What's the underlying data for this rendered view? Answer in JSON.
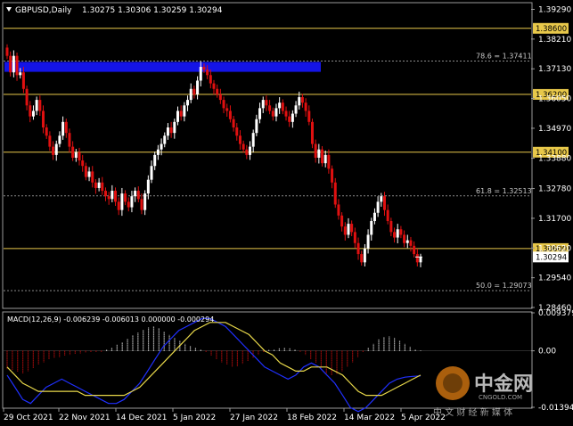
{
  "header": {
    "symbol_tf": "GBPUSD,Daily",
    "ohlc": "1.30275 1.30306 1.30259 1.30294"
  },
  "price_axis": {
    "ticks": [
      "1.39290",
      "1.38210",
      "1.37130",
      "1.36050",
      "1.34970",
      "1.33880",
      "1.32780",
      "1.31700",
      "1.30620",
      "1.29540",
      "1.28460"
    ],
    "tick_values": [
      1.3929,
      1.3821,
      1.3713,
      1.3605,
      1.3497,
      1.3388,
      1.3278,
      1.317,
      1.3062,
      1.2954,
      1.2846
    ],
    "range": [
      1.2846,
      1.395
    ]
  },
  "levels": [
    {
      "value": 1.386,
      "label": "1.38600",
      "color": "#e8c84a"
    },
    {
      "value": 1.362,
      "label": "1.36200",
      "color": "#e8c84a"
    },
    {
      "value": 1.341,
      "label": "1.34100",
      "color": "#e8c84a"
    },
    {
      "value": 1.306,
      "label": "1.30600",
      "color": "#e8c84a"
    }
  ],
  "current_price": {
    "value": 1.30294,
    "label": "1.30294"
  },
  "fibs": [
    {
      "value": 1.37411,
      "label": "78.6 = 1.37411"
    },
    {
      "value": 1.32513,
      "label": "61.8 = 1.32513"
    },
    {
      "value": 1.29073,
      "label": "50.0 = 1.29073"
    }
  ],
  "zone": {
    "top": 1.3738,
    "bottom": 1.3702,
    "color": "#1414e6"
  },
  "macd": {
    "label": "MACD(12,26,9) -0.006239 -0.006013 0.000000 -0.000294",
    "ticks": [
      "0.009379",
      "0.00",
      "-0.013941"
    ],
    "tick_values": [
      0.009379,
      0.0,
      -0.013941
    ]
  },
  "date_axis": [
    "29 Oct 2021",
    "22 Nov 2021",
    "14 Dec 2021",
    "5 Jan 2022",
    "27 Jan 2022",
    "18 Feb 2022",
    "14 Mar 2022",
    "5 Apr 2022"
  ],
  "chart_data": {
    "type": "candlestick",
    "close": [
      1.376,
      1.37,
      1.376,
      1.369,
      1.37,
      1.364,
      1.358,
      1.354,
      1.356,
      1.36,
      1.356,
      1.35,
      1.347,
      1.343,
      1.34,
      1.344,
      1.347,
      1.352,
      1.348,
      1.343,
      1.339,
      1.341,
      1.338,
      1.336,
      1.332,
      1.334,
      1.33,
      1.328,
      1.33,
      1.327,
      1.325,
      1.324,
      1.327,
      1.323,
      1.32,
      1.326,
      1.323,
      1.321,
      1.325,
      1.327,
      1.324,
      1.32,
      1.326,
      1.331,
      1.336,
      1.34,
      1.342,
      1.344,
      1.347,
      1.35,
      1.348,
      1.352,
      1.356,
      1.354,
      1.358,
      1.36,
      1.364,
      1.362,
      1.367,
      1.372,
      1.371,
      1.369,
      1.366,
      1.364,
      1.362,
      1.36,
      1.357,
      1.356,
      1.353,
      1.35,
      1.347,
      1.344,
      1.342,
      1.34,
      1.343,
      1.348,
      1.353,
      1.357,
      1.36,
      1.358,
      1.356,
      1.354,
      1.357,
      1.359,
      1.356,
      1.354,
      1.352,
      1.355,
      1.358,
      1.361,
      1.359,
      1.356,
      1.352,
      1.344,
      1.339,
      1.342,
      1.337,
      1.34,
      1.335,
      1.33,
      1.322,
      1.318,
      1.314,
      1.311,
      1.315,
      1.312,
      1.308,
      1.304,
      1.301,
      1.306,
      1.311,
      1.316,
      1.319,
      1.323,
      1.325,
      1.32,
      1.316,
      1.312,
      1.31,
      1.313,
      1.311,
      1.308,
      1.309,
      1.307,
      1.304,
      1.301,
      1.3029
    ],
    "macd_hist": [
      -0.0045,
      -0.0048,
      -0.0052,
      -0.0055,
      -0.005,
      -0.0042,
      -0.0035,
      -0.0028,
      -0.0022,
      -0.0018,
      -0.0015,
      -0.0012,
      -0.001,
      -0.0008,
      -0.0006,
      -0.0005,
      -0.0004,
      -0.0003,
      -0.0002,
      0.0003,
      0.0008,
      0.0015,
      0.0022,
      0.003,
      0.0038,
      0.0045,
      0.0052,
      0.0058,
      0.006,
      0.0055,
      0.0048,
      0.004,
      0.0032,
      0.0025,
      0.0018,
      0.0012,
      0.0008,
      0.0004,
      -0.0004,
      -0.0012,
      -0.002,
      -0.0028,
      -0.0035,
      -0.004,
      -0.0038,
      -0.0032,
      -0.0025,
      -0.0018,
      -0.001,
      -0.0004,
      0.0002,
      0.0004,
      0.0006,
      0.0008,
      0.0006,
      0.0003,
      -0.0002,
      -0.001,
      -0.002,
      -0.003,
      -0.0042,
      -0.0055,
      -0.006,
      -0.0058,
      -0.005,
      -0.004,
      -0.0028,
      -0.0015,
      -0.0004,
      0.0008,
      0.0018,
      0.0028,
      0.0034,
      0.0036,
      0.0032,
      0.0026,
      0.0018,
      0.001,
      0.0004,
      0.0001
    ],
    "macd_line": [
      -0.006,
      -0.009,
      -0.012,
      -0.013,
      -0.011,
      -0.009,
      -0.008,
      -0.007,
      -0.008,
      -0.009,
      -0.01,
      -0.011,
      -0.012,
      -0.013,
      -0.013,
      -0.012,
      -0.01,
      -0.008,
      -0.005,
      -0.002,
      0.001,
      0.003,
      0.005,
      0.006,
      0.007,
      0.008,
      0.008,
      0.007,
      0.006,
      0.004,
      0.002,
      0.0,
      -0.002,
      -0.004,
      -0.005,
      -0.006,
      -0.007,
      -0.006,
      -0.004,
      -0.003,
      -0.004,
      -0.006,
      -0.008,
      -0.011,
      -0.014,
      -0.015,
      -0.014,
      -0.012,
      -0.01,
      -0.008,
      -0.007,
      -0.0065,
      -0.0063,
      -0.0062
    ],
    "signal_line": [
      -0.004,
      -0.006,
      -0.008,
      -0.009,
      -0.01,
      -0.01,
      -0.01,
      -0.01,
      -0.01,
      -0.01,
      -0.011,
      -0.011,
      -0.011,
      -0.011,
      -0.011,
      -0.011,
      -0.01,
      -0.009,
      -0.007,
      -0.005,
      -0.003,
      -0.001,
      0.001,
      0.003,
      0.005,
      0.006,
      0.007,
      0.007,
      0.007,
      0.006,
      0.005,
      0.004,
      0.002,
      0.0,
      -0.001,
      -0.003,
      -0.004,
      -0.005,
      -0.005,
      -0.004,
      -0.004,
      -0.004,
      -0.005,
      -0.006,
      -0.008,
      -0.01,
      -0.011,
      -0.011,
      -0.011,
      -0.01,
      -0.009,
      -0.008,
      -0.007,
      -0.006
    ]
  },
  "watermark": {
    "title": "中金网",
    "sub": "CNGOLD.COM",
    "tagline": "中 文 财 经 新 媒 体"
  },
  "colors": {
    "bull": "#ffffff",
    "bear": "#e01010",
    "bull_highlight": "#22aa22",
    "macd_line": "#2030ff",
    "signal": "#e8d84a",
    "grid": "#808080"
  }
}
